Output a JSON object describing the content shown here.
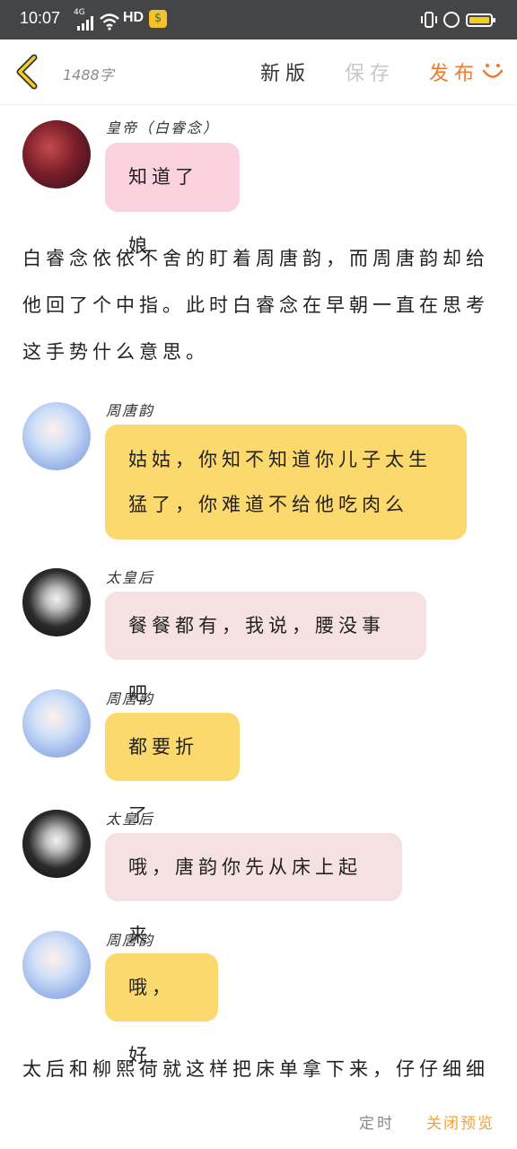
{
  "status_bar": {
    "time": "10:07",
    "network": "4G",
    "hd": "HD",
    "app_icon": "$"
  },
  "top_bar": {
    "word_count": "1488字",
    "new_version": "新版",
    "save": "保存",
    "publish": "发布"
  },
  "messages": [
    {
      "name": "皇帝（白睿念）",
      "text": "知道了娘"
    },
    {
      "name": "周唐韵",
      "lines": [
        "姑姑，你知不知道你儿子太生",
        "猛了，你难道不给他吃肉么"
      ]
    },
    {
      "name": "太皇后",
      "text": "餐餐都有，我说，腰没事吧"
    },
    {
      "name": "周唐韵",
      "text": "都要折了"
    },
    {
      "name": "太皇后",
      "text": "哦，唐韵你先从床上起来"
    },
    {
      "name": "周唐韵",
      "text": "哦，好"
    }
  ],
  "paragraphs": {
    "p1": [
      "白睿念依依不舍的盯着周唐韵，而周唐韵却给",
      "他回了个中指。此时白睿念在早朝一直在思考",
      "这手势什么意思。"
    ],
    "p2": [
      "太后和柳熙荷就这样把床单拿下来，仔仔细细"
    ]
  },
  "bottom_bar": {
    "timer": "定时",
    "close_preview": "关闭预览"
  },
  "colors": {
    "publish": "#f07a2e",
    "bubble_pink": "#fbd3df",
    "bubble_yellow": "#fcd96c",
    "bubble_rose": "#f5e0e2",
    "close_preview": "#f0a13a"
  },
  "icons": [
    "back-arrow-icon",
    "smiley-icon",
    "signal-icon",
    "wifi-icon",
    "vibrate-icon",
    "alarm-icon",
    "battery-icon"
  ]
}
